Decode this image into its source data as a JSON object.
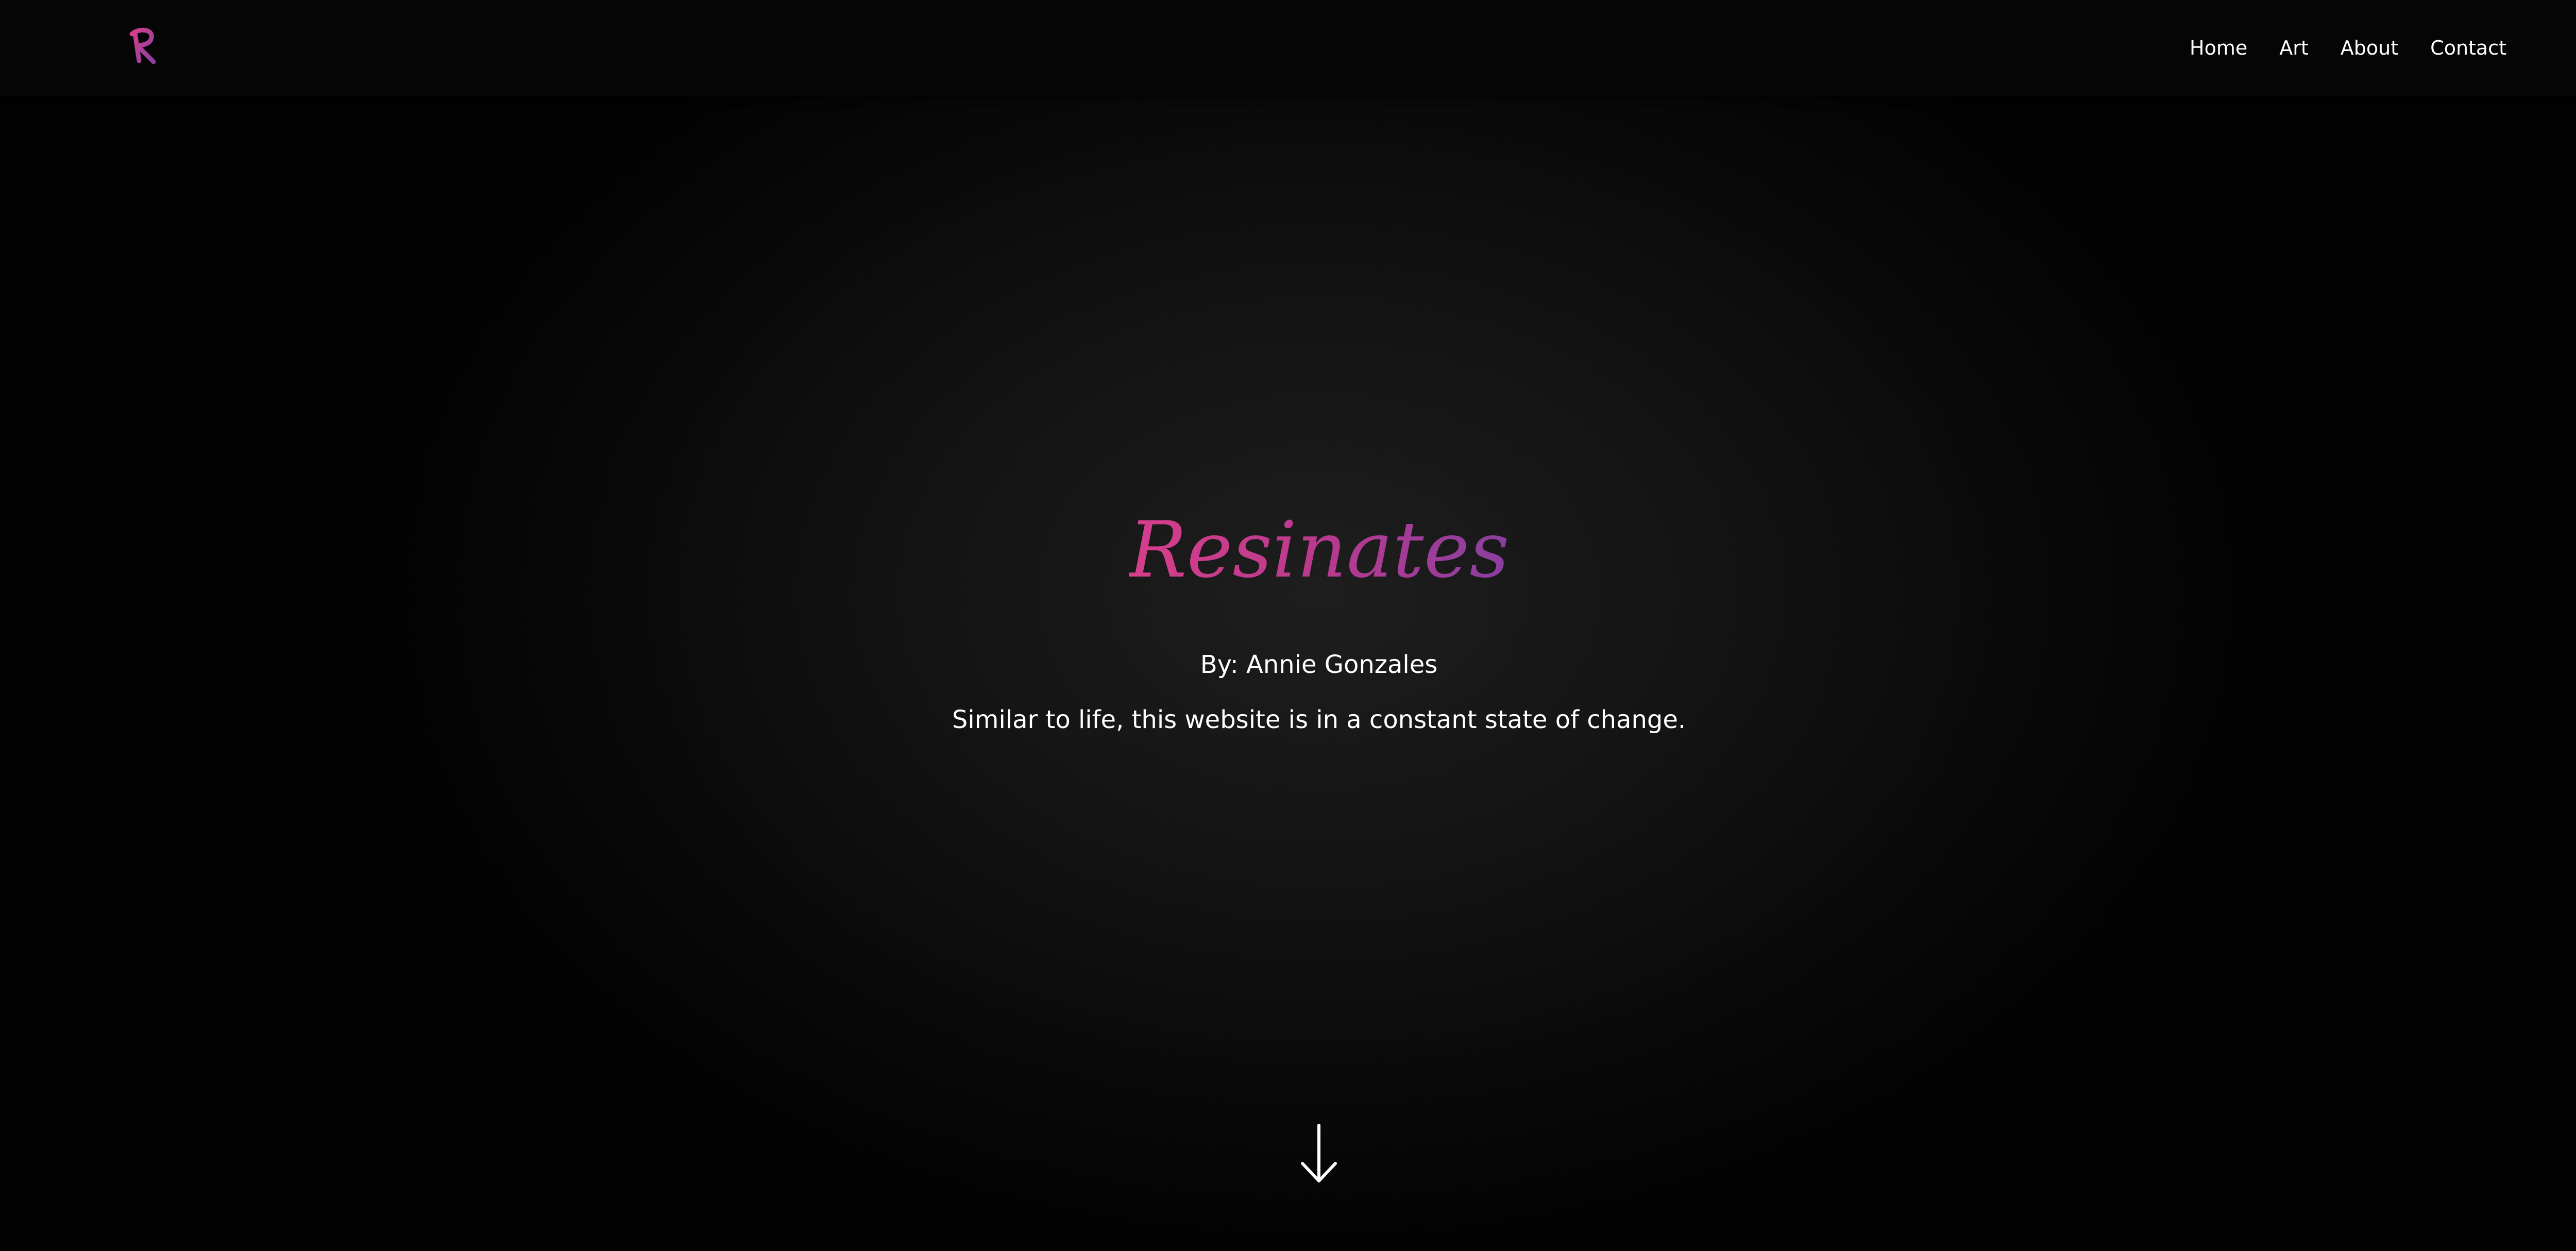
{
  "header": {
    "logo_letter": "R",
    "logo_colors": [
      "#d63f8c",
      "#8a3fa0"
    ],
    "nav_items": [
      {
        "label": "Home"
      },
      {
        "label": "Art"
      },
      {
        "label": "About"
      },
      {
        "label": "Contact"
      }
    ]
  },
  "hero": {
    "title": "Resinates",
    "title_gradient": [
      "#d63f8c",
      "#8a3fa0"
    ],
    "byline": "By: Annie Gonzales",
    "tagline": "Similar to life, this website is in a constant state of change.",
    "scroll_icon": "arrow-down-icon"
  },
  "colors": {
    "background": "#000000",
    "text": "#ffffff",
    "accent": "#c23d8f"
  }
}
